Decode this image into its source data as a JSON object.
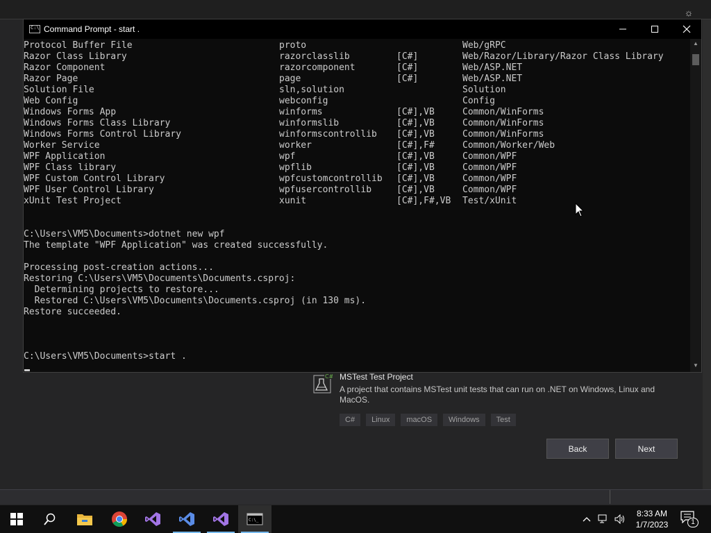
{
  "cmd_window": {
    "title": "Command Prompt - start  .",
    "icon_label": "C:\\",
    "template_rows": [
      {
        "name": "Protocol Buffer File",
        "short": "proto",
        "lang": "",
        "tags": "Web/gRPC"
      },
      {
        "name": "Razor Class Library",
        "short": "razorclasslib",
        "lang": "[C#]",
        "tags": "Web/Razor/Library/Razor Class Library"
      },
      {
        "name": "Razor Component",
        "short": "razorcomponent",
        "lang": "[C#]",
        "tags": "Web/ASP.NET"
      },
      {
        "name": "Razor Page",
        "short": "page",
        "lang": "[C#]",
        "tags": "Web/ASP.NET"
      },
      {
        "name": "Solution File",
        "short": "sln,solution",
        "lang": "",
        "tags": "Solution"
      },
      {
        "name": "Web Config",
        "short": "webconfig",
        "lang": "",
        "tags": "Config"
      },
      {
        "name": "Windows Forms App",
        "short": "winforms",
        "lang": "[C#],VB",
        "tags": "Common/WinForms"
      },
      {
        "name": "Windows Forms Class Library",
        "short": "winformslib",
        "lang": "[C#],VB",
        "tags": "Common/WinForms"
      },
      {
        "name": "Windows Forms Control Library",
        "short": "winformscontrollib",
        "lang": "[C#],VB",
        "tags": "Common/WinForms"
      },
      {
        "name": "Worker Service",
        "short": "worker",
        "lang": "[C#],F#",
        "tags": "Common/Worker/Web"
      },
      {
        "name": "WPF Application",
        "short": "wpf",
        "lang": "[C#],VB",
        "tags": "Common/WPF"
      },
      {
        "name": "WPF Class library",
        "short": "wpflib",
        "lang": "[C#],VB",
        "tags": "Common/WPF"
      },
      {
        "name": "WPF Custom Control Library",
        "short": "wpfcustomcontrollib",
        "lang": "[C#],VB",
        "tags": "Common/WPF"
      },
      {
        "name": "WPF User Control Library",
        "short": "wpfusercontrollib",
        "lang": "[C#],VB",
        "tags": "Common/WPF"
      },
      {
        "name": "xUnit Test Project",
        "short": "xunit",
        "lang": "[C#],F#,VB",
        "tags": "Test/xUnit"
      }
    ],
    "output_lines": [
      "",
      "",
      "C:\\Users\\VM5\\Documents>dotnet new wpf",
      "The template \"WPF Application\" was created successfully.",
      "",
      "Processing post-creation actions...",
      "Restoring C:\\Users\\VM5\\Documents\\Documents.csproj:",
      "  Determining projects to restore...",
      "  Restored C:\\Users\\VM5\\Documents\\Documents.csproj (in 130 ms).",
      "Restore succeeded.",
      "",
      "",
      "",
      "C:\\Users\\VM5\\Documents>start ."
    ]
  },
  "template_item": {
    "title": "MSTest Test Project",
    "description": "A project that contains MSTest unit tests that can run on .NET on Windows, Linux and MacOS.",
    "icon_badge": "C#",
    "tags": [
      "C#",
      "Linux",
      "macOS",
      "Windows",
      "Test"
    ]
  },
  "buttons": {
    "back": "Back",
    "next": "Next"
  },
  "clock": {
    "time": "8:33 AM",
    "date": "1/7/2023"
  },
  "notifications": {
    "count": "1"
  },
  "colors": {
    "accent": "#76b9ed",
    "console_bg": "#0c0c0c",
    "console_text": "#cccccc"
  }
}
